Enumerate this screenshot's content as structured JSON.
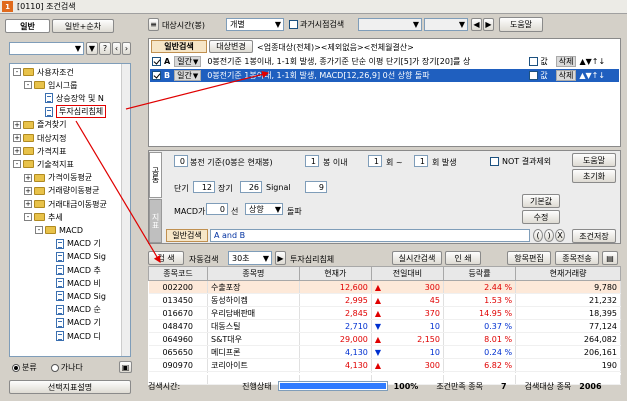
{
  "window": {
    "number": "1",
    "title": "[0110] 조건검색"
  },
  "left_panel": {
    "tabs": [
      "일반",
      "일반+순차"
    ],
    "tree": [
      {
        "label": "사용자조건",
        "indent": 0,
        "type": "folder",
        "expander": "-"
      },
      {
        "label": "임시그룹",
        "indent": 1,
        "type": "folder",
        "expander": "-"
      },
      {
        "label": "상승장악 및 N",
        "indent": 2,
        "type": "doc"
      },
      {
        "label": "투자심리침체",
        "indent": 2,
        "type": "doc",
        "selected": true
      },
      {
        "label": "즐겨찾기",
        "indent": 0,
        "type": "folder",
        "expander": "+"
      },
      {
        "label": "대상지정",
        "indent": 0,
        "type": "folder",
        "expander": "+"
      },
      {
        "label": "가격지표",
        "indent": 0,
        "type": "folder",
        "expander": "+"
      },
      {
        "label": "기술적지표",
        "indent": 0,
        "type": "folder",
        "expander": "-"
      },
      {
        "label": "가격이동평균",
        "indent": 1,
        "type": "folder",
        "expander": "+"
      },
      {
        "label": "거래량이동평균",
        "indent": 1,
        "type": "folder",
        "expander": "+"
      },
      {
        "label": "거래대금이동평균",
        "indent": 1,
        "type": "folder",
        "expander": "+"
      },
      {
        "label": "추세",
        "indent": 1,
        "type": "folder",
        "expander": "-"
      },
      {
        "label": "MACD",
        "indent": 2,
        "type": "folder",
        "expander": "-"
      },
      {
        "label": "MACD 기",
        "indent": 3,
        "type": "doc"
      },
      {
        "label": "MACD Sig",
        "indent": 3,
        "type": "doc"
      },
      {
        "label": "MACD 추",
        "indent": 3,
        "type": "doc"
      },
      {
        "label": "MACD 비",
        "indent": 3,
        "type": "doc"
      },
      {
        "label": "MACD Sig",
        "indent": 3,
        "type": "doc"
      },
      {
        "label": "MACD 순",
        "indent": 3,
        "type": "doc"
      },
      {
        "label": "MACD 기",
        "indent": 3,
        "type": "doc"
      },
      {
        "label": "MACD 디",
        "indent": 3,
        "type": "doc"
      }
    ],
    "radio_options": [
      "분류",
      "가나다"
    ],
    "bottom_button": "선택지표설명"
  },
  "top_bar": {
    "target_time_label": "대상시간(봉)",
    "target_time_value": "개별",
    "past_search_label": "과거시점검색",
    "help_button": "도움말"
  },
  "condition": {
    "tabs": [
      "일반검색",
      "대상변경"
    ],
    "target_text": "<업종대상(전체)><제외없음><전체월결산>",
    "rows": [
      {
        "letter": "A",
        "period": "일간",
        "text": "0봉전기준 1봉이내, 1-1회 발생, 종가기준 단순 이평 단기[5]가 장기[20]를 상",
        "value_label": "값",
        "delete": "삭제"
      },
      {
        "letter": "B",
        "period": "일간",
        "text": "0봉전기준 1봉이내, 1-1회 발생, MACD[12,26,9] 0선 상향 돌파",
        "value_label": "값",
        "delete": "삭제"
      }
    ]
  },
  "param_panel": {
    "side_tabs": [
      "공통",
      "지표"
    ],
    "row1": {
      "bong": "0",
      "t1": "봉전 기준(0봉은 현재봉)",
      "within": "1",
      "t2": "봉 이내",
      "c1": "1",
      "t3": "회 ~",
      "c2": "1",
      "t4": "회 발생",
      "not_label": "NOT 결과제외"
    },
    "row2": {
      "short_label": "단기",
      "short": "12",
      "long_label": "장기",
      "long": "26",
      "signal_label": "Signal",
      "signal": "9"
    },
    "row3": {
      "macd_label": "MACD가",
      "line": "0",
      "line_label": "선",
      "dir": "상향",
      "cross": "돌파"
    },
    "right_buttons": [
      "도움말",
      "초기화",
      "기본값",
      "수정",
      "조건저장"
    ],
    "logic_label": "일반검색",
    "logic_value": "A and B",
    "bracket_buttons": [
      "(",
      ")",
      "X"
    ]
  },
  "result_toolbar": {
    "search": "검 색",
    "auto_refresh_label": "자동검색",
    "auto_refresh_value": "30초",
    "condition_name": "투자심리침체",
    "realtime": "실시간검색",
    "print": "인  쇄",
    "edit_items": "항목편집",
    "transfer": "종목전송"
  },
  "table": {
    "headers": [
      "종목코드",
      "종목명",
      "현재가",
      "전일대비",
      "등락률",
      "현재거래량"
    ],
    "rows": [
      {
        "code": "002200",
        "name": "수출포장",
        "price": "12,600",
        "dir": "up",
        "change": "300",
        "rate": "2.44 %",
        "volume": "9,780",
        "hl": true
      },
      {
        "code": "013450",
        "name": "동성하이켐",
        "price": "2,995",
        "dir": "up",
        "change": "45",
        "rate": "1.53 %",
        "volume": "21,232"
      },
      {
        "code": "016670",
        "name": "우리담배판매",
        "price": "2,845",
        "dir": "up",
        "change": "370",
        "rate": "14.95 %",
        "volume": "18,395"
      },
      {
        "code": "048470",
        "name": "대동스틸",
        "price": "2,710",
        "dir": "dn",
        "change": "10",
        "rate": "0.37 %",
        "volume": "77,124"
      },
      {
        "code": "064960",
        "name": "S&T대우",
        "price": "29,000",
        "dir": "up",
        "change": "2,150",
        "rate": "8.01 %",
        "volume": "264,082"
      },
      {
        "code": "065650",
        "name": "메디프론",
        "price": "4,130",
        "dir": "dn",
        "change": "10",
        "rate": "0.24 %",
        "volume": "206,161"
      },
      {
        "code": "090970",
        "name": "코리아이트",
        "price": "4,130",
        "dir": "up",
        "change": "300",
        "rate": "6.82 %",
        "volume": "190"
      }
    ]
  },
  "status": {
    "search_time_label": "검색시간:",
    "progress_label": "진행상태",
    "progress": 1.0,
    "progress_text": "100%",
    "matches_label": "조건만족 종목",
    "matches": "7",
    "targets_label": "검색대상 종목",
    "targets": "2006"
  },
  "colors": {
    "selected_row": "#1f5fbf",
    "highlight_row": "#fde9d9",
    "up": "#e00000",
    "down": "#0030d0",
    "progress": "#2f7bff",
    "annotation_arrow": "#e00000"
  }
}
